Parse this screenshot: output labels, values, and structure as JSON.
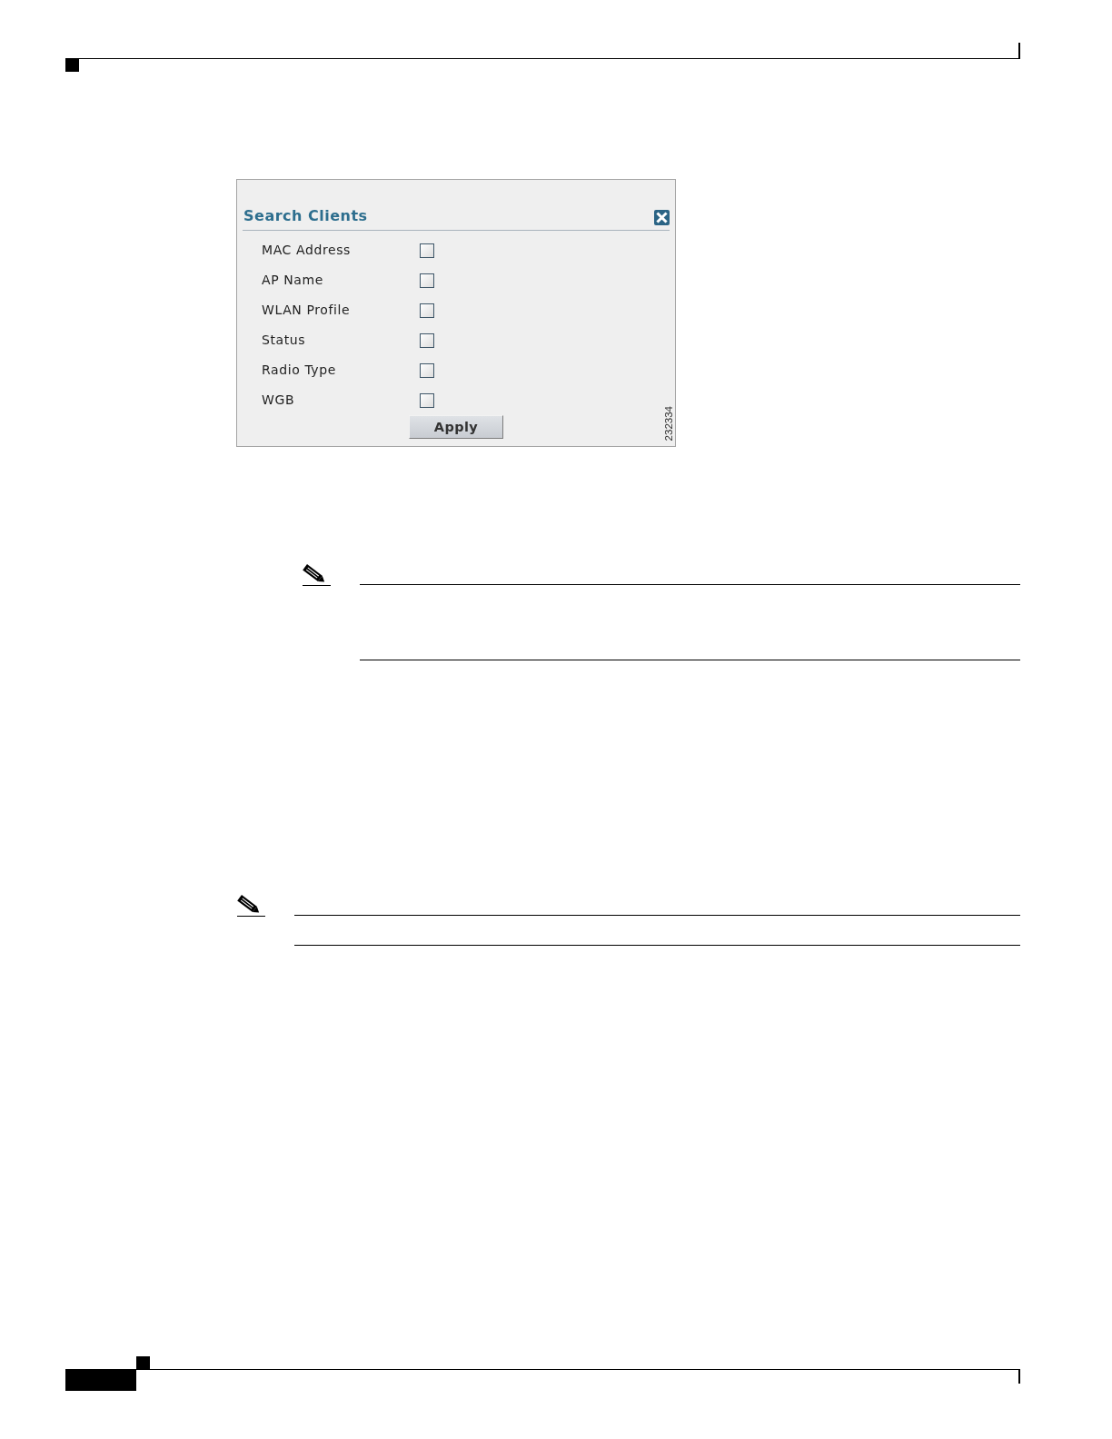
{
  "dialog": {
    "title": "Search Clients",
    "fields": [
      {
        "label": "MAC Address",
        "checked": false
      },
      {
        "label": "AP Name",
        "checked": false
      },
      {
        "label": "WLAN Profile",
        "checked": false
      },
      {
        "label": "Status",
        "checked": false
      },
      {
        "label": "Radio Type",
        "checked": false
      },
      {
        "label": "WGB",
        "checked": false
      }
    ],
    "button": "Apply"
  },
  "figure_number": "232334"
}
